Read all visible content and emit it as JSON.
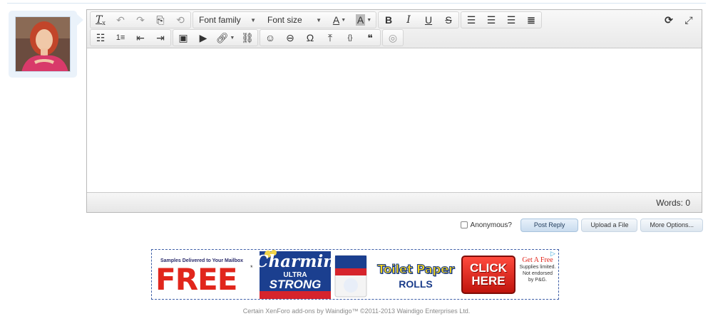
{
  "toolbar": {
    "font_family_label": "Font family",
    "font_size_label": "Font size",
    "text_color_glyph": "A",
    "bg_color_glyph": "A",
    "bold_glyph": "B",
    "italic_glyph": "I",
    "underline_glyph": "U",
    "strike_glyph": "S",
    "special_char_glyph": "Ω"
  },
  "editor": {
    "content": "",
    "word_count_label": "Words: 0"
  },
  "submit": {
    "anonymous_label": "Anonymous?",
    "post_reply_label": "Post Reply",
    "upload_label": "Upload a File",
    "more_options_label": "More Options..."
  },
  "ad": {
    "tagline": "Samples Delivered to Your Mailbox",
    "free": "FREE",
    "star": "*",
    "brand": "Charmin",
    "ultra": "ULTRA",
    "strong": "STRONG",
    "product_line1": "Toilet Paper",
    "product_line2": "ROLLS",
    "click_line1": "CLICK",
    "click_line2": "HERE",
    "get_free": "Get A Free",
    "fine1": "Supplies limited.",
    "fine2": "Not endorsed",
    "fine3": "by P&G."
  },
  "footer": {
    "text": "Certain XenForo add-ons by Waindigo™ ©2011-2013 Waindigo Enterprises Ltd."
  },
  "colors": {
    "ad_border": "#3e5fa8",
    "free_red": "#e1261c",
    "charmin_blue": "#1a3c8a",
    "button_blue": "#c9dcef"
  }
}
